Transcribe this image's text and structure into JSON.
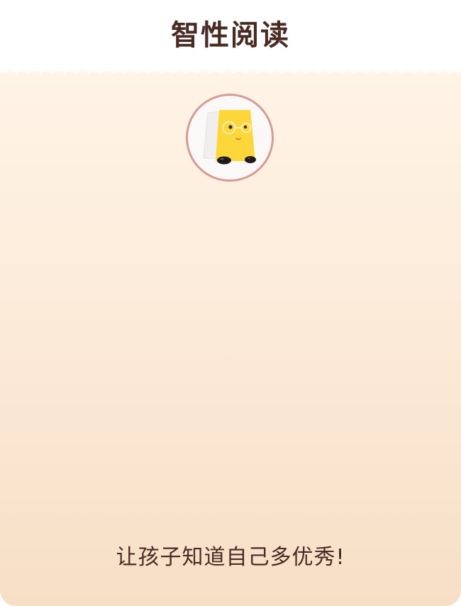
{
  "header": {
    "title": "智性阅读"
  },
  "card": {
    "mascot_icon": "book-mascot-icon",
    "slogan": "让孩子知道自己多优秀!"
  },
  "colors": {
    "title_text": "#4a2b24",
    "card_gradient_top": "#fff4e7",
    "card_gradient_bottom": "#f7dfc6",
    "avatar_border": "#d89a94",
    "mascot_yellow": "#fdd63a"
  }
}
